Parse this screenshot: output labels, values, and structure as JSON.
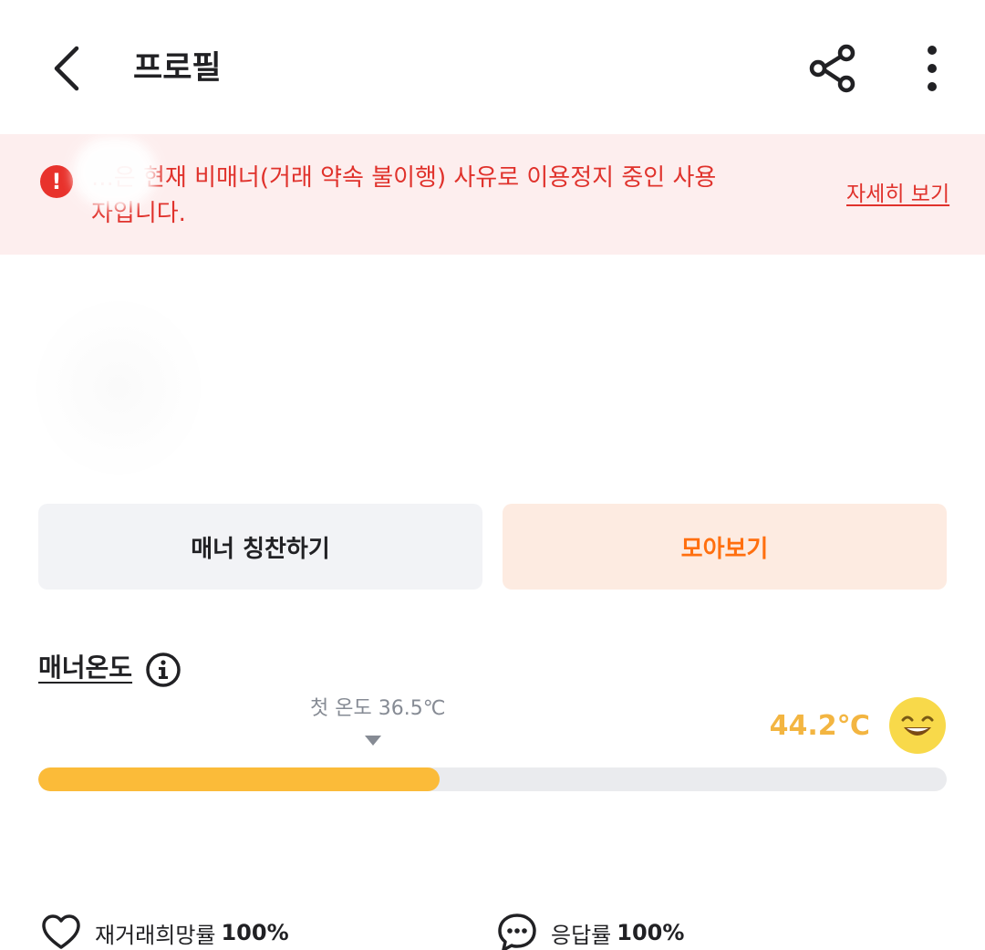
{
  "header": {
    "title": "프로필"
  },
  "warning": {
    "message": "...은 현재 비매너(거래 약속 불이행) 사유로 이용정지 중인 사용자입니다.",
    "link_label": "자세히 보기"
  },
  "actions": {
    "praise_label": "매너 칭찬하기",
    "collect_label": "모아보기"
  },
  "manner": {
    "title": "매너온도",
    "first_temp_label": "첫 온도 36.5℃",
    "temperature": "44.2℃",
    "temperature_fill_percent": 44.2,
    "bar_color": "#fbbb39",
    "temp_color": "#f3b541"
  },
  "stats": {
    "rebuy_label": "재거래희망률",
    "rebuy_value": "100%",
    "response_label": "응답률",
    "response_value": "100%"
  },
  "colors": {
    "warning_text": "#e0322c",
    "warning_bg": "#fdeeee",
    "accent": "#ff6f0f"
  }
}
